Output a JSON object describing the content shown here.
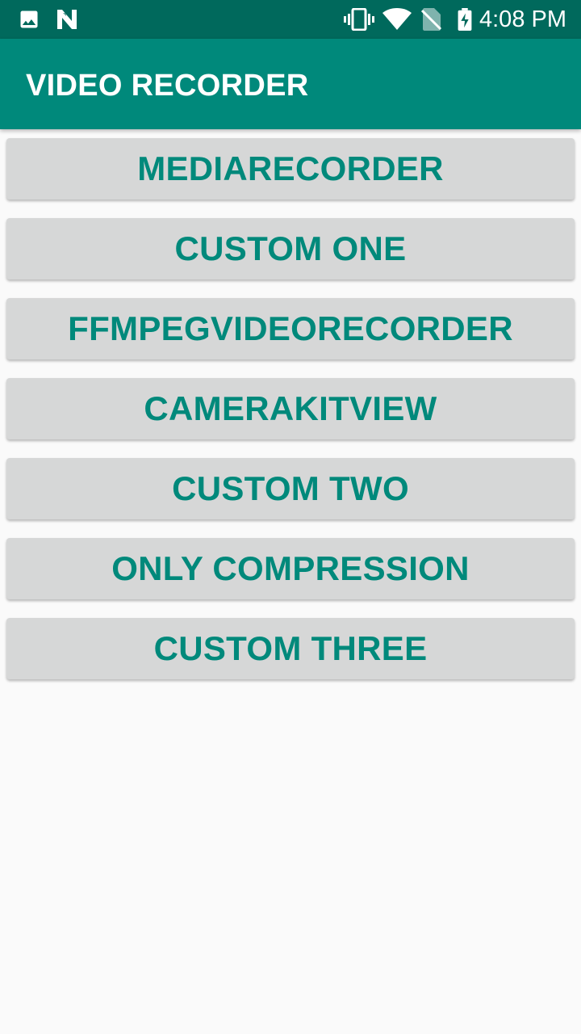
{
  "status_bar": {
    "time": "4:08 PM",
    "left_icons": [
      "image-icon",
      "n-icon"
    ],
    "right_icons": [
      "vibrate-icon",
      "wifi-icon",
      "no-sim-icon",
      "battery-charging-icon"
    ],
    "background": "#00695c"
  },
  "app_bar": {
    "title": "VIDEO RECORDER",
    "background": "#00897b"
  },
  "buttons": [
    {
      "label": "MEDIARECORDER"
    },
    {
      "label": "CUSTOM ONE"
    },
    {
      "label": "FFMPEGVIDEORECORDER"
    },
    {
      "label": "CAMERAKITVIEW"
    },
    {
      "label": "CUSTOM TWO"
    },
    {
      "label": "ONLY COMPRESSION"
    },
    {
      "label": "CUSTOM THREE"
    }
  ],
  "colors": {
    "accent": "#00897b",
    "button_bg": "#d6d7d7",
    "page_bg": "#fafafa"
  }
}
